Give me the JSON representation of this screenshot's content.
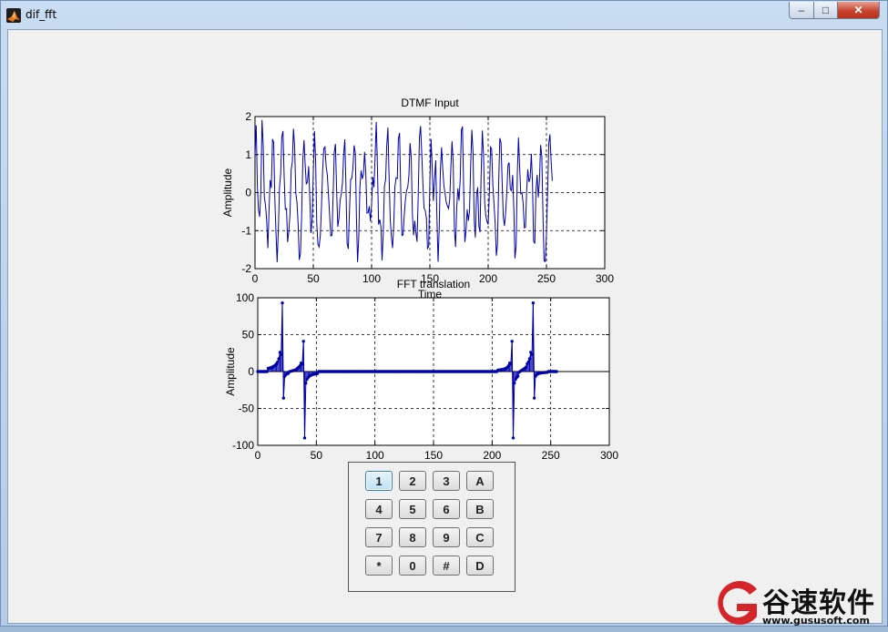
{
  "window": {
    "title": "dif_fft",
    "min_symbol": "–",
    "max_symbol": "□",
    "close_symbol": "✕",
    "icon": "matlab-figure-icon"
  },
  "chart_data": [
    {
      "type": "line",
      "title": "DTMF Input",
      "xlabel": "Time",
      "ylabel": "Amplitude",
      "xlim": [
        0,
        300
      ],
      "ylim": [
        -2,
        2
      ],
      "xticks": [
        0,
        50,
        100,
        150,
        200,
        250,
        300
      ],
      "yticks": [
        -2,
        -1,
        0,
        1,
        2
      ],
      "grid": true,
      "color": "#0000a8",
      "series": [
        {
          "values": [
            1.0,
            1.77,
            0.16,
            -0.46,
            -0.64,
            0.03,
            1.91,
            1.24,
            -0.11,
            -0.33,
            -0.73,
            -1.46,
            -0.48,
            0.33,
            0.12,
            1.41,
            1.32,
            -0.19,
            -1.03,
            -1.83,
            -1.0,
            0.14,
            0.5,
            1.46,
            1.62,
            0.41,
            -0.44,
            -0.42,
            -1.3,
            -1.02,
            -0.58,
            0.6,
            0.81,
            1.68,
            1.21,
            -0.02,
            -0.26,
            -0.85,
            -1.77,
            -1.6,
            -0.62,
            0.87,
            1.38,
            0.76,
            0.23,
            0.27,
            0.69,
            -0.15,
            -1.06,
            -0.7,
            0.53,
            1.62,
            0.78,
            -0.81,
            -1.36,
            -1.43,
            -1.14,
            -0.36,
            0.56,
            1.16,
            1.2,
            0.69,
            0.46,
            -0.03,
            -0.58,
            -1.14,
            -1.12,
            -0.04,
            1.06,
            1.28,
            0.07,
            -0.9,
            -0.67,
            -0.21,
            -0.04,
            0.25,
            1.0,
            1.4,
            0.23,
            -1.34,
            -1.48,
            -0.51,
            0.35,
            0.37,
            0.64,
            1.24,
            1.05,
            -0.68,
            -1.83,
            -1.19,
            0.16,
            0.58,
            0.36,
            0.48,
            1.07,
            0.52,
            -0.54,
            -0.53,
            -0.36,
            -0.75,
            -0.31,
            0.41,
            0.14,
            0.9,
            1.86,
            0.68,
            -0.84,
            -0.71,
            -0.89,
            -1.78,
            -1.06,
            0.17,
            0.34,
            1.22,
            1.71,
            0.43,
            -0.73,
            -1.18,
            -1.46,
            -0.87,
            0.16,
            0.39,
            0.37,
            1.41,
            1.57,
            0.07,
            -1.13,
            -1.11,
            -0.61,
            -0.2,
            0.06,
            0.14,
            0.46,
            1.3,
            0.96,
            -0.56,
            -1.12,
            -0.74,
            -1.05,
            -1.29,
            -0.08,
            1.43,
            1.75,
            1.08,
            0.25,
            -0.41,
            -0.47,
            -0.68,
            -1.47,
            -1.41,
            0.3,
            1.41,
            0.63,
            -0.22,
            0.35,
            0.85,
            -0.64,
            -1.82,
            -0.98,
            0.56,
            1.19,
            0.64,
            0.18,
            -0.01,
            -0.25,
            -0.35,
            -0.42,
            -0.18,
            0.62,
            1.35,
            0.8,
            -0.94,
            -1.43,
            -0.44,
            0.11,
            -0.21,
            0.35,
            1.64,
            1.74,
            0.09,
            -1.3,
            -1.0,
            -0.44,
            -0.74,
            -0.5,
            0.73,
            1.65,
            1.05,
            -0.68,
            -1.18,
            -0.07,
            0.14,
            -0.88,
            -1.04,
            0.48,
            1.63,
            0.98,
            -0.27,
            -0.61,
            -0.76,
            -0.84,
            -0.02,
            1.2,
            1.15,
            0.23,
            -0.31,
            -0.81,
            -1.66,
            -1.36,
            0.21,
            1.43,
            1.32,
            0.25,
            -0.64,
            -0.88,
            -0.52,
            0.04,
            0.73,
            0.79,
            0.09,
            0.05,
            0.46,
            -0.47,
            -1.73,
            -1.4,
            0.48,
            1.45,
            0.64,
            -0.03,
            0.0,
            -0.28,
            -0.93,
            -0.91,
            0.02,
            0.61,
            0.28,
            0.38,
            1.02,
            0.3,
            -1.28,
            -1.34,
            0.08,
            0.47,
            -0.13,
            0.31,
            1.25,
            0.96,
            -0.6,
            -1.8,
            -1.81,
            -1.1,
            0.06,
            1.3,
            1.53,
            0.84,
            0.31
          ]
        }
      ]
    },
    {
      "type": "line",
      "title": "FFT translation",
      "xlabel": "",
      "ylabel": "Amplitude",
      "xlim": [
        0,
        300
      ],
      "ylim": [
        -100,
        100
      ],
      "xticks": [
        0,
        50,
        100,
        150,
        200,
        250,
        300
      ],
      "yticks": [
        -100,
        -50,
        0,
        50,
        100
      ],
      "grid": true,
      "color": "#0000a8",
      "n_points": 256,
      "peaks": [
        {
          "x": 21,
          "y": 93,
          "y2": -36
        },
        {
          "x": 39,
          "y": 41,
          "y2": -90
        },
        {
          "x": 217,
          "y": 41,
          "y2": -90
        },
        {
          "x": 235,
          "y": 93,
          "y2": -36
        }
      ]
    }
  ],
  "keypad": {
    "keys": [
      "1",
      "2",
      "3",
      "A",
      "4",
      "5",
      "6",
      "B",
      "7",
      "8",
      "9",
      "C",
      "*",
      "0",
      "#",
      "D"
    ],
    "focused_key": "1"
  },
  "watermark": {
    "text": "谷速软件",
    "url": "www.gususoft.com",
    "color": "#d4252b"
  }
}
